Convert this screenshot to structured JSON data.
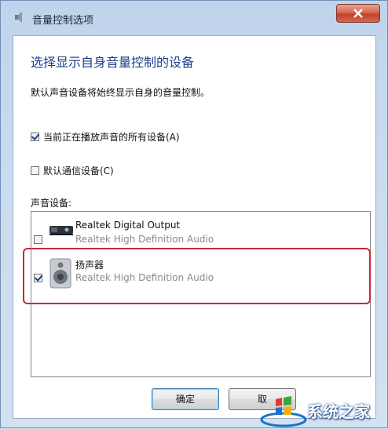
{
  "window": {
    "title": "音量控制选项"
  },
  "main": {
    "heading": "选择显示自身音量控制的设备",
    "description": "默认声音设备将始终显示自身的音量控制。",
    "options": [
      {
        "label": "当前正在播放声音的所有设备(A)",
        "checked": true
      },
      {
        "label": "默认通信设备(C)",
        "checked": false
      }
    ],
    "devices_label": "声音设备:",
    "devices": [
      {
        "name": "Realtek Digital Output",
        "subtitle": "Realtek High Definition Audio",
        "checked": false,
        "icon": "digital-output-icon"
      },
      {
        "name": "扬声器",
        "subtitle": "Realtek High Definition Audio",
        "checked": true,
        "icon": "speaker-icon"
      }
    ]
  },
  "buttons": {
    "ok": "确定",
    "cancel": "取"
  },
  "watermark": {
    "text": "系统之家",
    "icon": "windows-logo-icon"
  },
  "colors": {
    "highlight": "#c22b33",
    "heading": "#1e3f8a"
  }
}
